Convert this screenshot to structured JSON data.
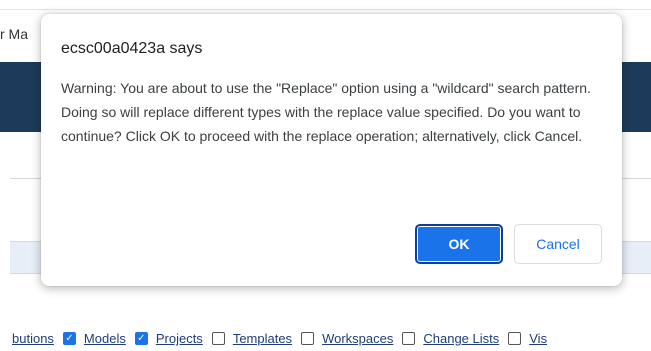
{
  "background": {
    "title_fragment": "r Ma",
    "filter_row": [
      {
        "label": "butions",
        "checkbox": false
      },
      {
        "label": "Models",
        "checkbox": true,
        "checked": true
      },
      {
        "label": "Projects",
        "checkbox": true,
        "checked": true
      },
      {
        "label": "Templates",
        "checkbox": true,
        "checked": false
      },
      {
        "label": "Workspaces",
        "checkbox": true,
        "checked": false
      },
      {
        "label": "Change Lists",
        "checkbox": true,
        "checked": false
      },
      {
        "label": "Vis",
        "checkbox": true,
        "checked": false
      }
    ]
  },
  "dialog": {
    "title": "ecsc00a0423a says",
    "message": "Warning: You are about to use the \"Replace\" option using a \"wildcard\" search pattern. Doing so will replace different types with the replace value specified. Do you want to continue? Click OK to proceed with the replace operation; alternatively, click Cancel.",
    "ok_label": "OK",
    "cancel_label": "Cancel"
  },
  "colors": {
    "navbar": "#1e3a5a",
    "primary": "#1a73e8",
    "link": "#1f3d7a"
  }
}
